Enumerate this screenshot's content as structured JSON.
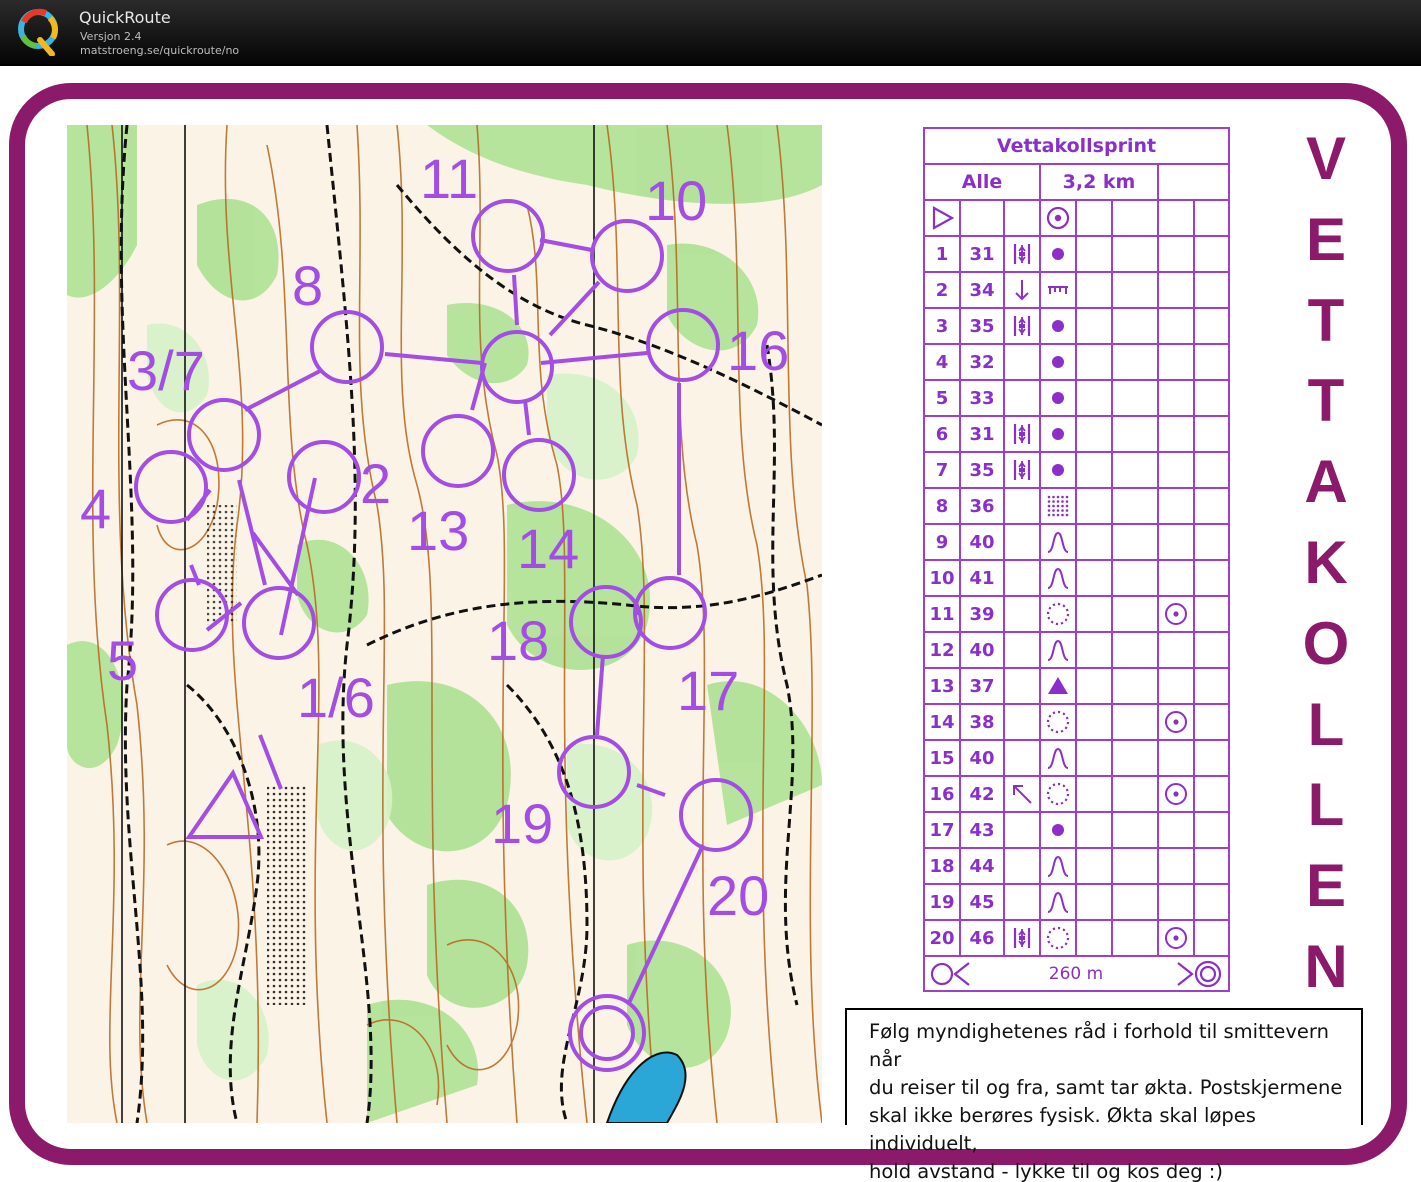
{
  "app": {
    "title": "QuickRoute",
    "version": "Versjon 2.4",
    "url": "matstroeng.se/quickroute/no"
  },
  "vertical_title": [
    "V",
    "E",
    "T",
    "T",
    "A",
    "K",
    "O",
    "L",
    "L",
    "E",
    "N"
  ],
  "map": {
    "course_color": "#a24ee2",
    "frame_color": "#8b1a6b",
    "control_labels": [
      {
        "id": "lbl-11",
        "text": "11"
      },
      {
        "id": "lbl-10",
        "text": "10"
      },
      {
        "id": "lbl-8",
        "text": "8"
      },
      {
        "id": "lbl-37",
        "text": "3/7"
      },
      {
        "id": "lbl-16",
        "text": "16"
      },
      {
        "id": "lbl-2",
        "text": "2"
      },
      {
        "id": "lbl-4",
        "text": "4"
      },
      {
        "id": "lbl-13",
        "text": "13"
      },
      {
        "id": "lbl-14",
        "text": "14"
      },
      {
        "id": "lbl-18",
        "text": "18"
      },
      {
        "id": "lbl-5",
        "text": "5"
      },
      {
        "id": "lbl-16b",
        "text": "1/6"
      },
      {
        "id": "lbl-17",
        "text": "17"
      },
      {
        "id": "lbl-19",
        "text": "19"
      },
      {
        "id": "lbl-20",
        "text": "20"
      }
    ]
  },
  "description": {
    "event": "Vettakollsprint",
    "class": "Alle",
    "length": "3,2 km",
    "rows": [
      {
        "num": "1",
        "code": "31",
        "dir": "between",
        "feature": "dot",
        "extra": ""
      },
      {
        "num": "2",
        "code": "34",
        "dir": "down",
        "feature": "fence",
        "extra": ""
      },
      {
        "num": "3",
        "code": "35",
        "dir": "between",
        "feature": "dot",
        "extra": ""
      },
      {
        "num": "4",
        "code": "32",
        "dir": "",
        "feature": "dot",
        "extra": ""
      },
      {
        "num": "5",
        "code": "33",
        "dir": "",
        "feature": "dot",
        "extra": ""
      },
      {
        "num": "6",
        "code": "31",
        "dir": "between",
        "feature": "dot",
        "extra": ""
      },
      {
        "num": "7",
        "code": "35",
        "dir": "between",
        "feature": "dot",
        "extra": ""
      },
      {
        "num": "8",
        "code": "36",
        "dir": "",
        "feature": "stony",
        "extra": ""
      },
      {
        "num": "9",
        "code": "40",
        "dir": "",
        "feature": "knoll",
        "extra": ""
      },
      {
        "num": "10",
        "code": "41",
        "dir": "",
        "feature": "knoll",
        "extra": ""
      },
      {
        "num": "11",
        "code": "39",
        "dir": "",
        "feature": "dotted-circle",
        "extra": "point-circle"
      },
      {
        "num": "12",
        "code": "40",
        "dir": "",
        "feature": "knoll",
        "extra": ""
      },
      {
        "num": "13",
        "code": "37",
        "dir": "",
        "feature": "triangle",
        "extra": ""
      },
      {
        "num": "14",
        "code": "38",
        "dir": "",
        "feature": "dotted-circle",
        "extra": "point-circle"
      },
      {
        "num": "15",
        "code": "40",
        "dir": "",
        "feature": "knoll",
        "extra": ""
      },
      {
        "num": "16",
        "code": "42",
        "dir": "northwest",
        "feature": "dotted-circle",
        "extra": "point-circle"
      },
      {
        "num": "17",
        "code": "43",
        "dir": "",
        "feature": "dot",
        "extra": ""
      },
      {
        "num": "18",
        "code": "44",
        "dir": "",
        "feature": "knoll",
        "extra": ""
      },
      {
        "num": "19",
        "code": "45",
        "dir": "",
        "feature": "knoll",
        "extra": ""
      },
      {
        "num": "20",
        "code": "46",
        "dir": "between",
        "feature": "dotted-circle",
        "extra": "point-circle"
      }
    ],
    "finish_distance": "260 m"
  },
  "notice": {
    "lines": [
      "Følg myndighetenes råd i forhold til smittevern når",
      "du reiser til og fra, samt tar økta. Postskjermene",
      "skal ikke berøres fysisk. Økta skal løpes individuelt,",
      "hold avstand - lykke til og kos deg :)"
    ]
  }
}
